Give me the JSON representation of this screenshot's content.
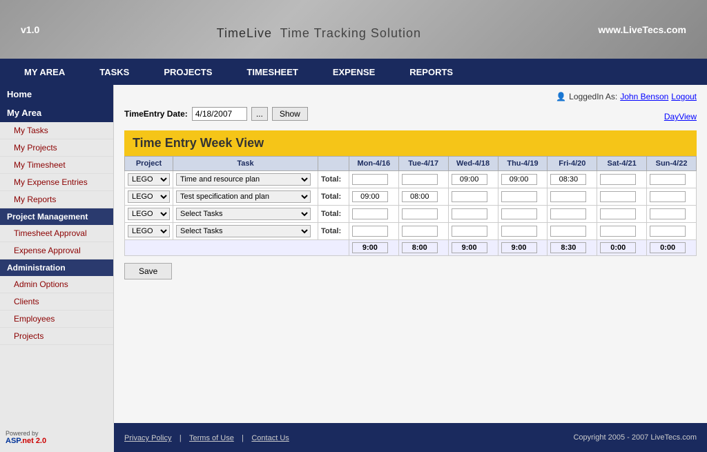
{
  "header": {
    "version": "v1.0",
    "title": "TimeLive",
    "subtitle": "Time Tracking Solution",
    "url": "www.LiveTecs.com"
  },
  "nav": {
    "items": [
      {
        "label": "MY AREA"
      },
      {
        "label": "TASKS"
      },
      {
        "label": "PROJECTS"
      },
      {
        "label": "TIMESHEET"
      },
      {
        "label": "EXPENSE"
      },
      {
        "label": "REPORTS"
      }
    ]
  },
  "sidebar": {
    "home": "Home",
    "my_area": "My Area",
    "my_area_items": [
      {
        "label": "My Tasks"
      },
      {
        "label": "My Projects"
      },
      {
        "label": "My Timesheet"
      },
      {
        "label": "My Expense Entries"
      },
      {
        "label": "My Reports"
      }
    ],
    "project_management": "Project Management",
    "project_items": [
      {
        "label": "Timesheet Approval"
      },
      {
        "label": "Expense Approval"
      }
    ],
    "administration": "Administration",
    "admin_items": [
      {
        "label": "Admin Options"
      },
      {
        "label": "Clients"
      },
      {
        "label": "Employees"
      },
      {
        "label": "Projects"
      }
    ]
  },
  "content": {
    "logged_in_as": "LoggedIn As:",
    "user_name": "John Benson",
    "logout": "Logout",
    "day_view": "DayView",
    "date_label": "TimeEntry Date:",
    "date_value": "4/18/2007",
    "show_btn": "Show",
    "week_title": "Time Entry Week View",
    "table_headers": [
      "Project",
      "Task",
      "",
      "Mon-4/16",
      "Tue-4/17",
      "Wed-4/18",
      "Thu-4/19",
      "Fri-4/20",
      "Sat-4/21",
      "Sun-4/22"
    ],
    "rows": [
      {
        "project": "LEGO",
        "task": "Time and resource plan",
        "total_label": "Total:",
        "mon": "",
        "tue": "",
        "wed": "09:00",
        "thu": "09:00",
        "fri": "08:30",
        "sat": "",
        "sun": ""
      },
      {
        "project": "LEGO",
        "task": "Test specification and plan",
        "total_label": "Total:",
        "mon": "09:00",
        "tue": "08:00",
        "wed": "",
        "thu": "",
        "fri": "",
        "sat": "",
        "sun": ""
      },
      {
        "project": "LEGO",
        "task": "Select Tasks",
        "total_label": "Total:",
        "mon": "",
        "tue": "",
        "wed": "",
        "thu": "",
        "fri": "",
        "sat": "",
        "sun": ""
      },
      {
        "project": "LEGO",
        "task": "Select Tasks",
        "total_label": "Total:",
        "mon": "",
        "tue": "",
        "wed": "",
        "thu": "",
        "fri": "",
        "sat": "",
        "sun": ""
      }
    ],
    "totals_row": {
      "mon": "9:00",
      "tue": "8:00",
      "wed": "9:00",
      "thu": "9:00",
      "fri": "8:30",
      "sat": "0:00",
      "sun": "0:00"
    },
    "save_btn": "Save"
  },
  "footer": {
    "privacy": "Privacy Policy",
    "terms": "Terms of Use",
    "contact": "Contact Us",
    "copyright": "Copyright 2005 - 2007 LiveTecs.com",
    "powered_by": "Powered by",
    "asp_version": "ASP.net 2.0"
  }
}
